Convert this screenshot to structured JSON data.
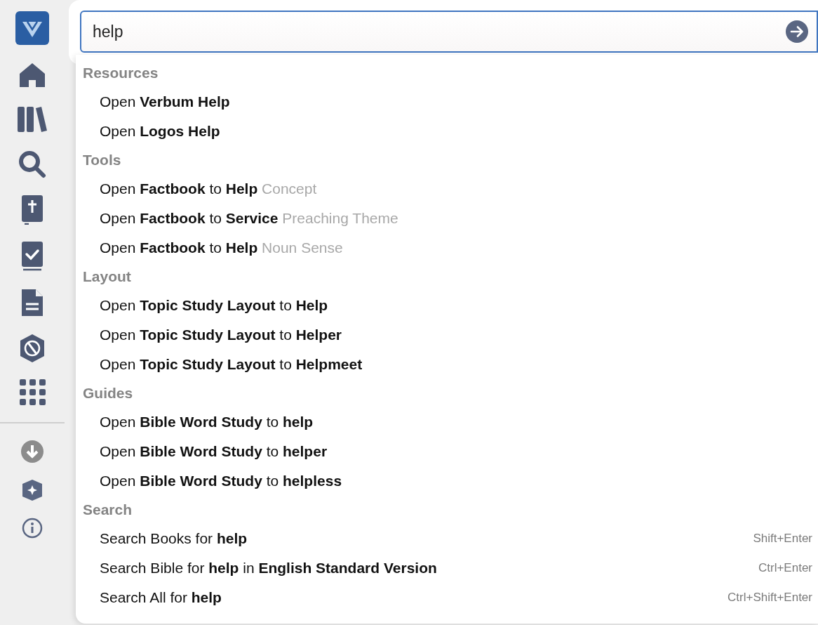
{
  "search": {
    "value": "help"
  },
  "groups": [
    {
      "title": "Resources",
      "items": [
        {
          "text": "Open **Verbum Help**"
        },
        {
          "text": "Open **Logos Help**"
        }
      ]
    },
    {
      "title": "Tools",
      "items": [
        {
          "text": "Open **Factbook** to **Help**",
          "hint": "Concept"
        },
        {
          "text": "Open **Factbook** to **Service**",
          "hint": "Preaching Theme"
        },
        {
          "text": "Open **Factbook** to **Help**",
          "hint": "Noun Sense"
        }
      ]
    },
    {
      "title": "Layout",
      "items": [
        {
          "text": "Open **Topic Study Layout** to **Help**"
        },
        {
          "text": "Open **Topic Study Layout** to **Helper**"
        },
        {
          "text": "Open **Topic Study Layout** to **Helpmeet**"
        }
      ]
    },
    {
      "title": "Guides",
      "items": [
        {
          "text": "Open **Bible Word Study** to **help**"
        },
        {
          "text": "Open **Bible Word Study** to **helper**"
        },
        {
          "text": "Open **Bible Word Study** to **helpless**"
        }
      ]
    },
    {
      "title": "Search",
      "items": [
        {
          "text": "Search Books for **help**",
          "shortcut": "Shift+Enter"
        },
        {
          "text": "Search Bible for **help** in **English Standard Version**",
          "shortcut": "Ctrl+Enter"
        },
        {
          "text": "Search All for **help**",
          "shortcut": "Ctrl+Shift+Enter"
        }
      ]
    }
  ]
}
